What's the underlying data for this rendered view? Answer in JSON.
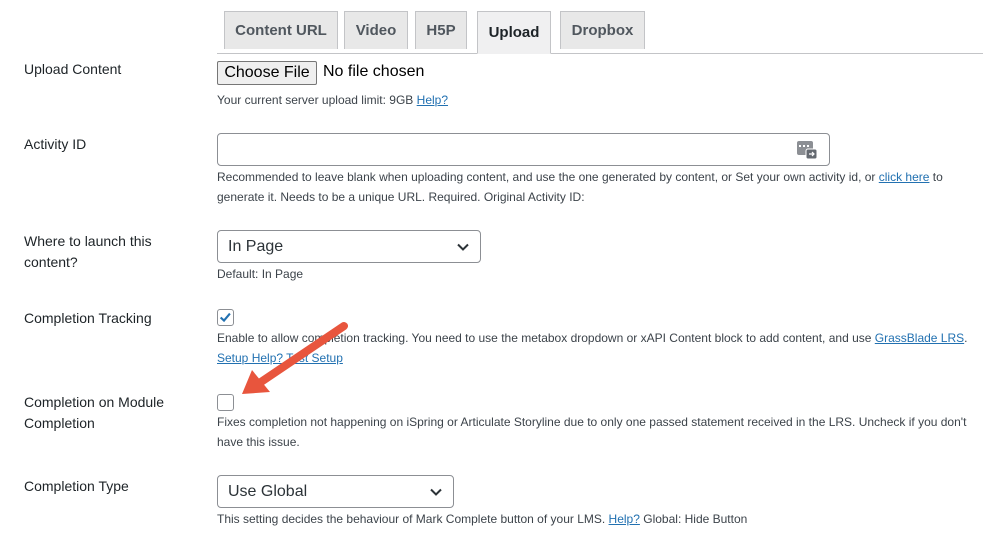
{
  "tabs": [
    {
      "label": "Content URL"
    },
    {
      "label": "Video"
    },
    {
      "label": "H5P"
    },
    {
      "label": "Upload",
      "active": true
    },
    {
      "label": "Dropbox"
    }
  ],
  "upload_content": {
    "label": "Upload Content",
    "button_label": "Choose File",
    "file_status": "No file chosen",
    "limit_text": "Your current server upload limit: 9GB",
    "help_link": "Help?"
  },
  "activity_id": {
    "label": "Activity ID",
    "value": "",
    "icon": "generate-id-icon",
    "desc_1": "Recommended to leave blank when uploading content, and use the one generated by content, or Set your own activity id, or",
    "click_here": "click here",
    "desc_2": "to",
    "desc_3": "generate it. Needs to be a unique URL. Required. Original Activity ID:"
  },
  "launch": {
    "label": "Where to launch this content?",
    "value": "In Page",
    "default_text": "Default: In Page"
  },
  "completion_tracking": {
    "label": "Completion Tracking",
    "checked": true,
    "desc": "Enable to allow completion tracking. You need to use the metabox dropdown or xAPI Content block to add content, and use",
    "grassblade_link": "GrassBlade LRS",
    "period": ".",
    "setup_help": "Setup Help?",
    "test_setup": "Test Setup"
  },
  "module_completion": {
    "label": "Completion on Module Completion",
    "checked": false,
    "desc": "Fixes completion not happening on iSpring or Articulate Storyline due to only one passed statement received in the LRS. Uncheck if you don't have this issue."
  },
  "completion_type": {
    "label": "Completion Type",
    "value": "Use Global",
    "desc_1": "This setting decides the behaviour of Mark Complete button of your LMS.",
    "help_link": "Help?",
    "desc_2": "Global: Hide Button"
  },
  "colors": {
    "link": "#2271b1",
    "check": "#2271b1",
    "annotation_arrow": "#e8553d"
  }
}
